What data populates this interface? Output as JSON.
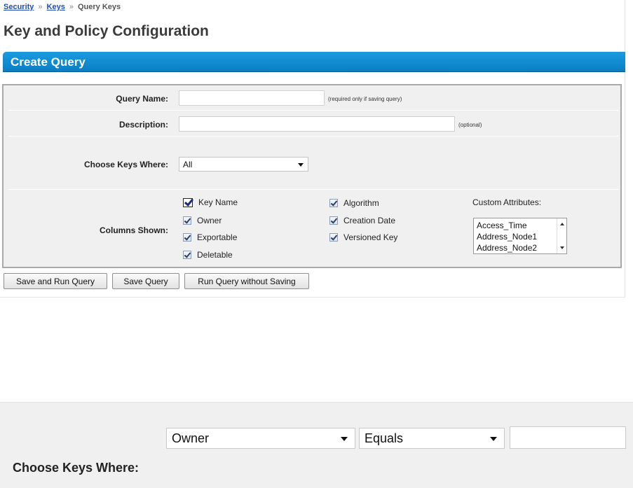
{
  "breadcrumb": {
    "items": [
      "Security",
      "Keys",
      "Query Keys"
    ]
  },
  "page": {
    "title": "Key and Policy Configuration"
  },
  "section": {
    "title": "Create Query"
  },
  "form": {
    "query_name": {
      "label": "Query Name:",
      "value": "",
      "hint": "(required only if saving query)"
    },
    "description": {
      "label": "Description:",
      "value": "",
      "hint": "(optional)"
    },
    "choose_keys": {
      "label": "Choose Keys Where:",
      "selected": "All"
    },
    "columns": {
      "label": "Columns Shown:",
      "col1": [
        {
          "label": "Key Name",
          "checked": true
        },
        {
          "label": "Owner",
          "checked": true
        },
        {
          "label": "Exportable",
          "checked": true
        },
        {
          "label": "Deletable",
          "checked": true
        }
      ],
      "col2": [
        {
          "label": "Algorithm",
          "checked": true
        },
        {
          "label": "Creation Date",
          "checked": true
        },
        {
          "label": "Versioned Key",
          "checked": true
        }
      ],
      "custom_attributes": {
        "label": "Custom Attributes:",
        "options": [
          "Access_Time",
          "Address_Node1",
          "Address_Node2"
        ]
      }
    }
  },
  "buttons": {
    "save_run": "Save and Run Query",
    "save": "Save Query",
    "run_no_save": "Run Query without Saving"
  },
  "zoom": {
    "field_select": "Owner",
    "operator_select": "Equals",
    "value_input": "",
    "label": "Choose Keys Where:"
  }
}
